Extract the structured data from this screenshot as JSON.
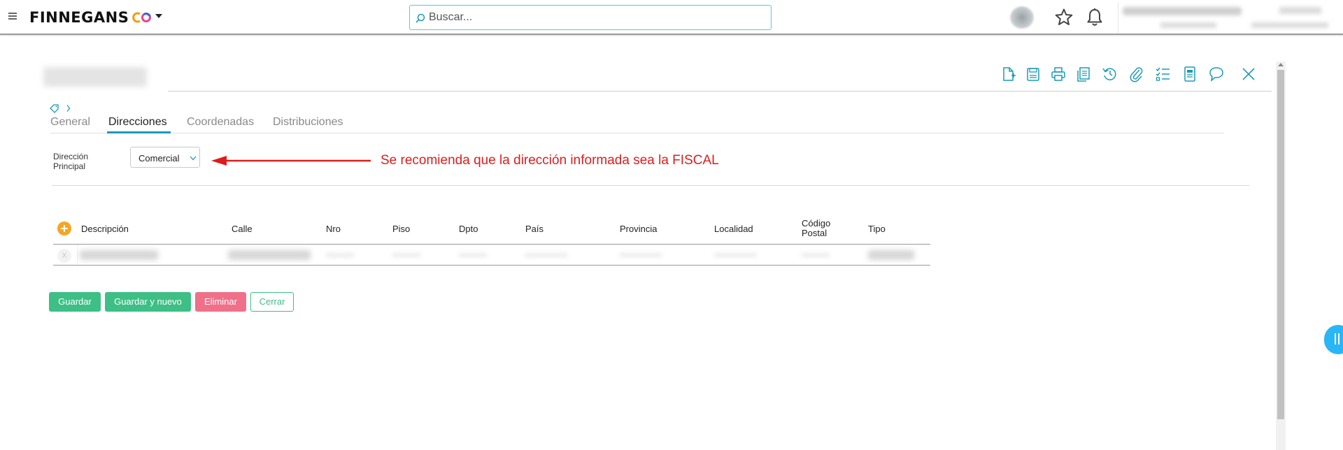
{
  "header": {
    "logo_text": "FINNEGANS",
    "logo_mark": "CO",
    "search_placeholder": "Buscar...",
    "icons": [
      "menu-icon",
      "search-icon",
      "star-icon",
      "bell-icon"
    ]
  },
  "toolbar": {
    "icons": [
      "new-document-icon",
      "save-icon",
      "print-icon",
      "copy-icon",
      "history-icon",
      "attach-icon",
      "checklist-icon",
      "report-icon",
      "comment-icon",
      "close-icon"
    ]
  },
  "tabs": [
    {
      "label": "General",
      "active": false
    },
    {
      "label": "Direcciones",
      "active": true
    },
    {
      "label": "Coordenadas",
      "active": false
    },
    {
      "label": "Distribuciones",
      "active": false
    }
  ],
  "form": {
    "direccion_label_1": "Dirección",
    "direccion_label_2": "Principal",
    "direccion_value": "Comercial"
  },
  "annotation": {
    "text": "Se recomienda que la dirección informada sea la FISCAL",
    "color": "#e11b1b"
  },
  "table": {
    "columns": [
      "Descripción",
      "Calle",
      "Nro",
      "Piso",
      "Dpto",
      "País",
      "Provincia",
      "Localidad",
      "Código",
      "Postal",
      "Tipo"
    ],
    "row_delete": "X"
  },
  "buttons": {
    "save": "Guardar",
    "save_new": "Guardar y nuevo",
    "delete": "Eliminar",
    "close": "Cerrar"
  },
  "colors": {
    "accent": "#1a9bb5",
    "success": "#3dbf85",
    "danger": "#f0708a",
    "add": "#f5a623",
    "side_handle": "#29b6f6"
  }
}
